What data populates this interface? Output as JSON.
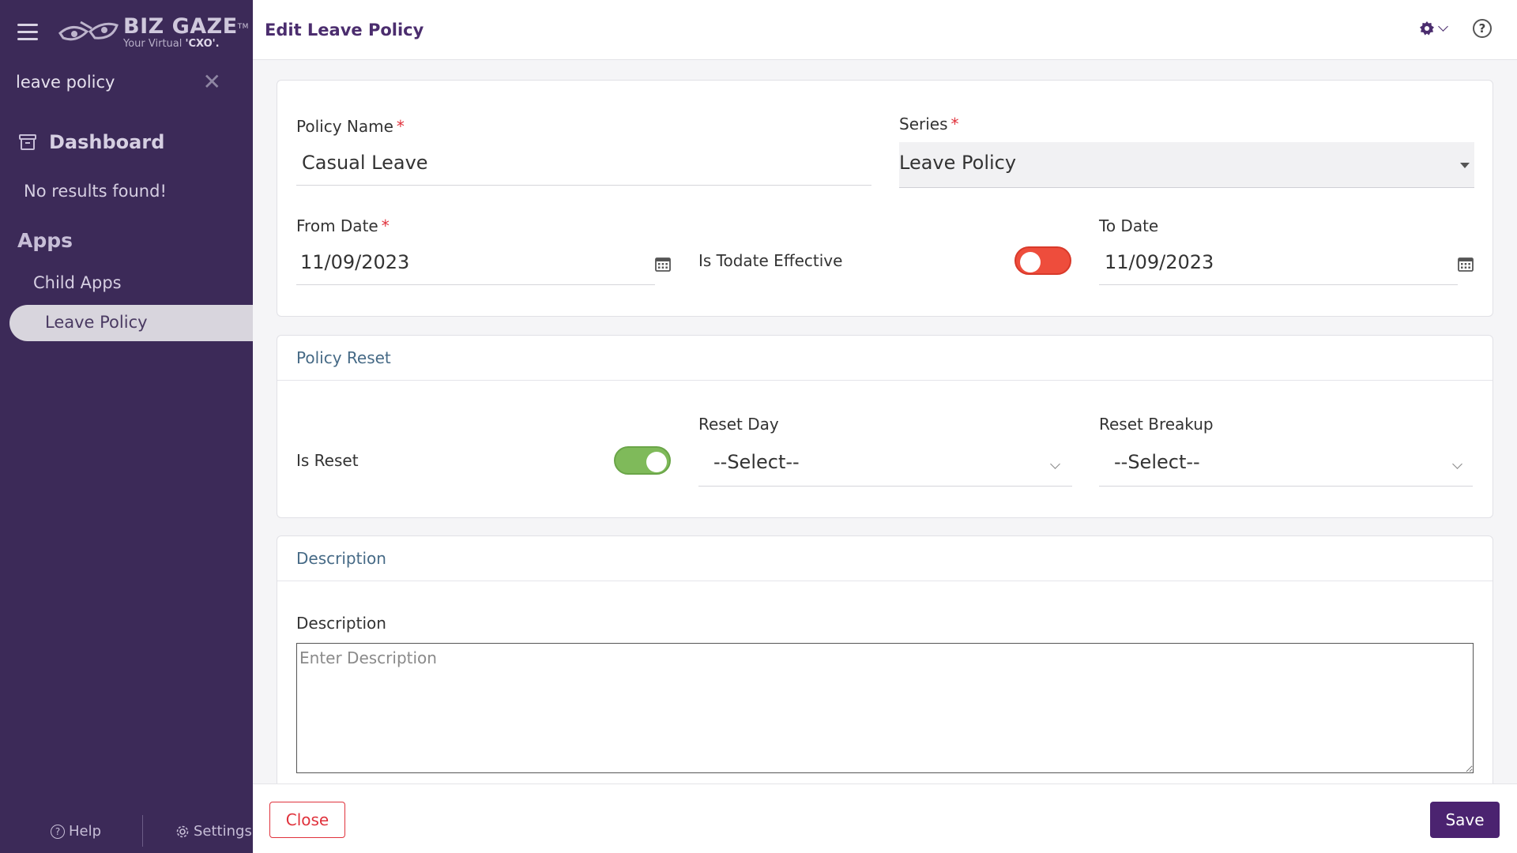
{
  "sidebar": {
    "logo": {
      "name": "BIZ GAZE",
      "trademark": "TM",
      "tagline_prefix": "Your Virtual ",
      "tagline_emphasis": "'CXO'."
    },
    "search": {
      "value": "leave policy"
    },
    "dashboard_label": "Dashboard",
    "no_results": "No results found!",
    "apps_title": "Apps",
    "items": [
      {
        "label": "Child Apps"
      },
      {
        "label": "Leave Policy",
        "active": true
      }
    ],
    "footer": {
      "help": "Help",
      "settings": "Settings"
    }
  },
  "header": {
    "title": "Edit Leave Policy"
  },
  "form": {
    "policy_name": {
      "label": "Policy Name",
      "required": "*",
      "value": "Casual Leave"
    },
    "series": {
      "label": "Series",
      "required": "*",
      "value": "Leave Policy"
    },
    "from_date": {
      "label": "From Date",
      "required": "*",
      "value": "11/09/2023"
    },
    "is_todate_effective": {
      "label": "Is Todate Effective",
      "on": false
    },
    "to_date": {
      "label": "To Date",
      "value": "11/09/2023"
    }
  },
  "policy_reset": {
    "title": "Policy Reset",
    "is_reset": {
      "label": "Is Reset",
      "on": true
    },
    "reset_day": {
      "label": "Reset Day",
      "value": "--Select--"
    },
    "reset_breakup": {
      "label": "Reset Breakup",
      "value": "--Select--"
    }
  },
  "description": {
    "title": "Description",
    "label": "Description",
    "placeholder": "Enter Description"
  },
  "footer": {
    "close_label": "Close",
    "save_label": "Save"
  },
  "colors": {
    "sidebar_bg": "#3c2a58",
    "brand_purple": "#4b2370",
    "toggle_off": "#ee4d3c",
    "toggle_on": "#7fba5a",
    "required": "#e0323c",
    "section_title": "#466a86"
  }
}
